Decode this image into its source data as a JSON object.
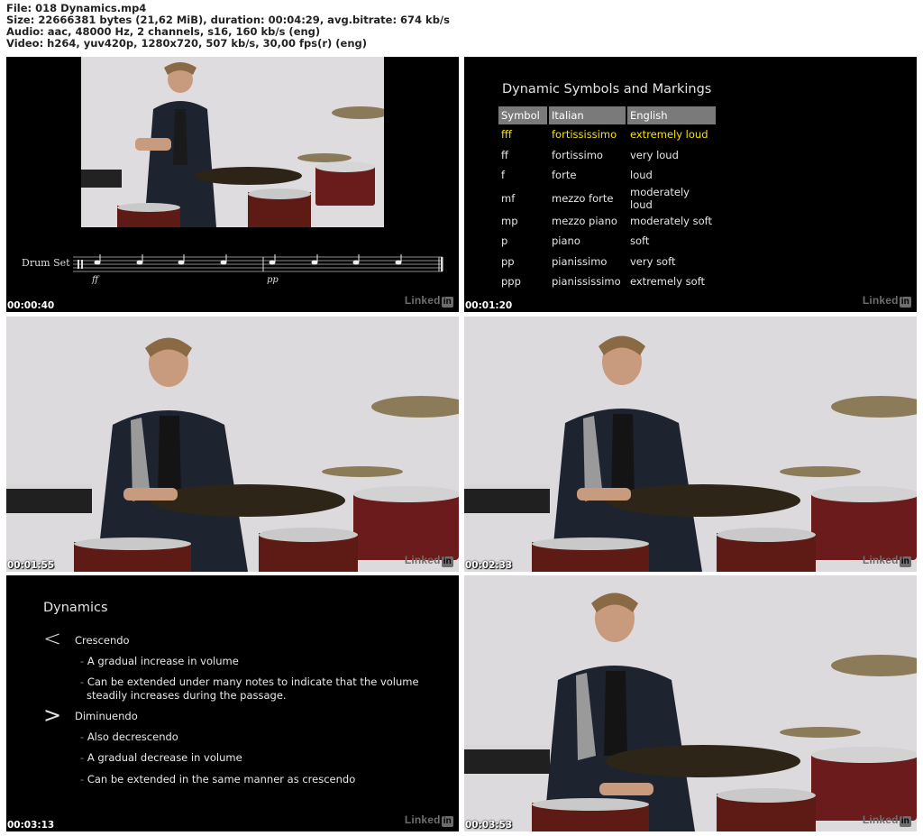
{
  "header": {
    "file": "File: 018 Dynamics.mp4",
    "size": "Size: 22666381 bytes (21,62 MiB), duration: 00:04:29, avg.bitrate: 674 kb/s",
    "audio": "Audio: aac, 48000 Hz, 2 channels, s16, 160 kb/s (eng)",
    "video": "Video: h264, yuv420p, 1280x720, 507 kb/s, 30,00 fps(r) (eng)"
  },
  "watermark": {
    "text": "Linked",
    "badge": "in"
  },
  "frames": [
    {
      "timestamp": "00:00:40",
      "staff_label": "Drum Set",
      "dyn1": "ff",
      "dyn2": "pp"
    },
    {
      "timestamp": "00:01:20"
    },
    {
      "timestamp": "00:01:55"
    },
    {
      "timestamp": "00:02:33"
    },
    {
      "timestamp": "00:03:13"
    },
    {
      "timestamp": "00:03:53"
    }
  ],
  "table": {
    "title": "Dynamic Symbols and Markings",
    "headers": [
      "Symbol",
      "Italian",
      "English"
    ],
    "rows": [
      [
        "fff",
        "fortississimo",
        "extremely loud"
      ],
      [
        "ff",
        "fortissimo",
        "very loud"
      ],
      [
        "f",
        "forte",
        "loud"
      ],
      [
        "mf",
        "mezzo forte",
        "moderately loud"
      ],
      [
        "mp",
        "mezzo piano",
        "moderately soft"
      ],
      [
        "p",
        "piano",
        "soft"
      ],
      [
        "pp",
        "pianissimo",
        "very soft"
      ],
      [
        "ppp",
        "pianississimo",
        "extremely soft"
      ]
    ],
    "highlight_color": "#f6e300"
  },
  "slide": {
    "title": "Dynamics",
    "crescendo_symbol": "<",
    "crescendo": "Crescendo",
    "c1": "A gradual increase in volume",
    "c2a": "Can be extended under many notes to indicate that the volume",
    "c2b": "steadily increases during the passage.",
    "diminuendo_symbol": ">",
    "diminuendo": "Diminuendo",
    "d1": "Also decrescendo",
    "d2": "A gradual decrease in volume",
    "d3": "Can be extended in the same manner as crescendo"
  }
}
